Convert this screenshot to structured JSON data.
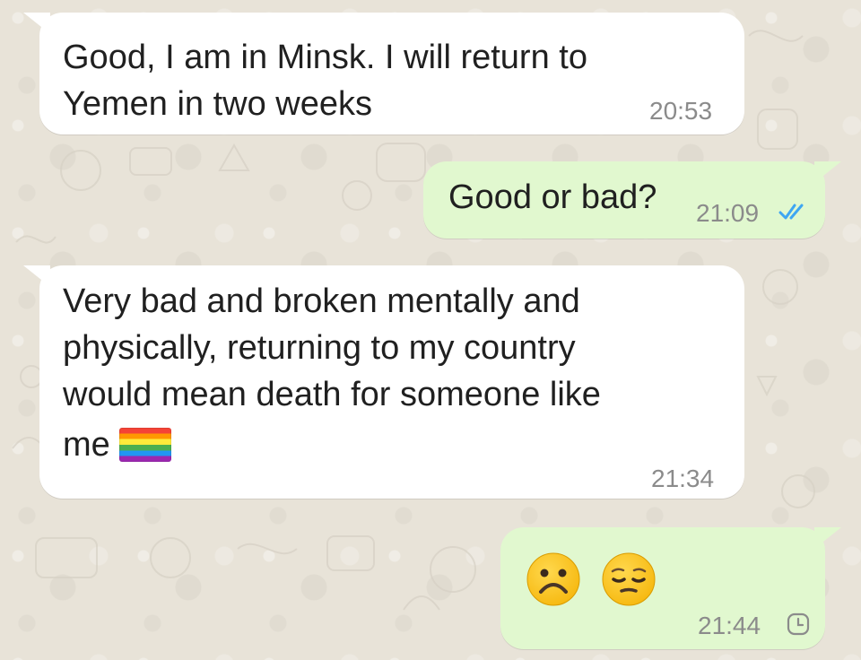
{
  "messages": [
    {
      "direction": "incoming",
      "text": "Good, I am in Minsk. I will return to\nYemen in two weeks",
      "time": "20:53"
    },
    {
      "direction": "outgoing",
      "text": "Good or bad?",
      "time": "21:09",
      "status_icon": "double-check-read-icon"
    },
    {
      "direction": "incoming",
      "text_lines": [
        "Very bad and broken mentally and",
        "physically, returning to my country",
        "would mean death for someone like",
        "me"
      ],
      "emoji": "rainbow-flag-icon",
      "time": "21:34"
    },
    {
      "direction": "outgoing",
      "emojis": [
        "frowning-face-icon",
        "pensive-face-icon"
      ],
      "time": "21:44",
      "status_icon": "pending-clock-icon"
    }
  ],
  "colors": {
    "incoming_bubble": "#ffffff",
    "outgoing_bubble": "#e1f8cf",
    "read_ticks": "#3ea6f2",
    "timestamp": "#8b8b8b",
    "chat_background": "#e8e3d8"
  }
}
